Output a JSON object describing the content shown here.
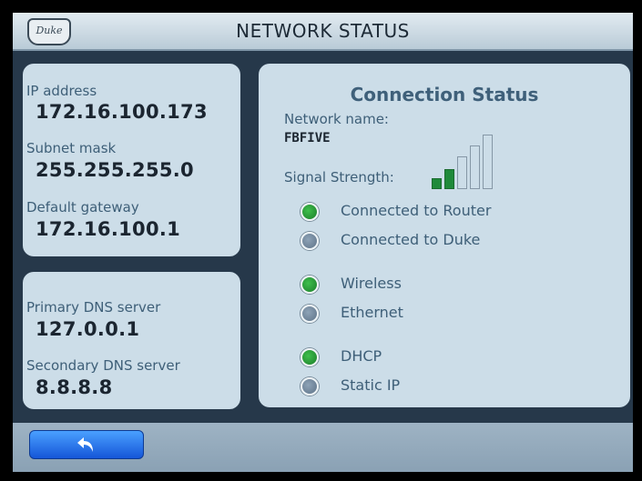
{
  "header": {
    "title": "NETWORK STATUS",
    "logo_text": "Duke"
  },
  "ip_panel": {
    "ip_label": "IP address",
    "ip_value": "172.16.100.173",
    "subnet_label": "Subnet mask",
    "subnet_value": "255.255.255.0",
    "gateway_label": "Default gateway",
    "gateway_value": "172.16.100.1"
  },
  "dns_panel": {
    "primary_label": "Primary DNS server",
    "primary_value": "127.0.0.1",
    "secondary_label": "Secondary DNS server",
    "secondary_value": "8.8.8.8"
  },
  "connection": {
    "title": "Connection Status",
    "network_name_label": "Network name:",
    "network_name": "FBFIVE",
    "signal_label": "Signal Strength:",
    "signal_bars_total": 5,
    "signal_bars_active": 2,
    "indicators": [
      {
        "label": "Connected to Router",
        "active": true
      },
      {
        "label": "Connected to Duke",
        "active": false
      },
      {
        "label": "Wireless",
        "active": true
      },
      {
        "label": "Ethernet",
        "active": false
      },
      {
        "label": "DHCP",
        "active": true
      },
      {
        "label": "Static IP",
        "active": false
      }
    ]
  },
  "colors": {
    "active_green": "#1f8a3a",
    "inactive_gray": "#5e7388",
    "accent_blue": "#1556d8"
  },
  "footer": {
    "back_icon": "back-arrow-icon"
  }
}
